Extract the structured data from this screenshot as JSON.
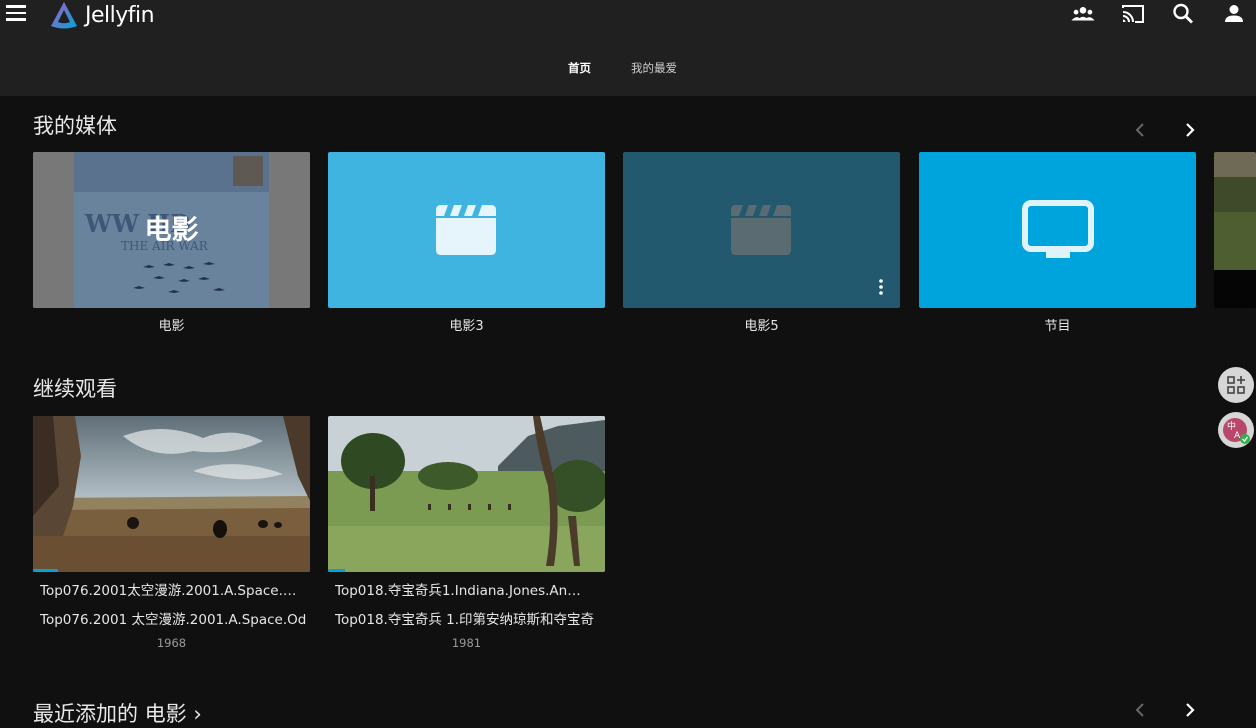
{
  "app": {
    "name": "Jellyfin"
  },
  "header": {
    "menu_icon": "hamburger-menu-icon",
    "icons": [
      "users-icon",
      "cast-icon",
      "search-icon",
      "user-icon"
    ]
  },
  "tabs": [
    {
      "label": "首页",
      "active": true
    },
    {
      "label": "我的最爱",
      "active": false
    }
  ],
  "my_media": {
    "title": "我的媒体",
    "items": [
      {
        "label": "电影",
        "overlay": "电影",
        "kind": "poster"
      },
      {
        "label": "电影3",
        "kind": "clapper",
        "color": "#3fb4e0"
      },
      {
        "label": "电影5",
        "kind": "clapper",
        "color": "#22596e"
      },
      {
        "label": "节目",
        "kind": "tv",
        "color": "#00a4dc"
      }
    ]
  },
  "continue_watching": {
    "title": "继续观看",
    "items": [
      {
        "title": "Top076.2001太空漫游.2001.A.Space.…",
        "subtitle": "Top076.2001 太空漫游.2001.A.Space.Od",
        "year": "1968",
        "progress": 0.09
      },
      {
        "title": "Top018.夺宝奇兵1.Indiana.Jones.An…",
        "subtitle": "Top018.夺宝奇兵 1.印第安纳琼斯和夺宝奇",
        "year": "1981",
        "progress": 0.06
      }
    ]
  },
  "recent": {
    "title": "最近添加的 电影 ›"
  },
  "colors": {
    "accent": "#00a4dc",
    "topbar": "#202020",
    "background": "#101010"
  }
}
